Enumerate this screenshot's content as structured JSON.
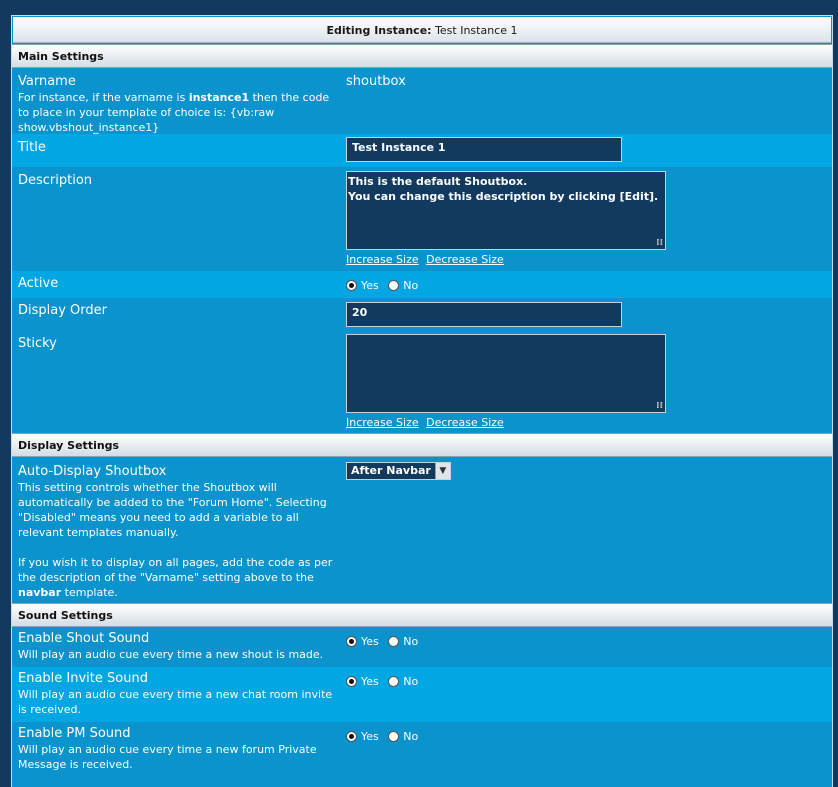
{
  "header": {
    "prefix": "Editing Instance:",
    "instance_name": "Test Instance 1"
  },
  "main_settings": {
    "section_title": "Main Settings",
    "varname": {
      "title": "Varname",
      "desc_pre": "For instance, if the varname is ",
      "desc_bold": "instance1",
      "desc_post": " then the code to place in your template of choice is: {vb:raw show.vbshout_instance1}",
      "value": "shoutbox"
    },
    "title": {
      "label": "Title",
      "value": "Test Instance 1"
    },
    "description": {
      "label": "Description",
      "line1": "This is the default Shoutbox.",
      "line2": "You can change this description by clicking [Edit].",
      "increase": "Increase Size",
      "decrease": "Decrease Size"
    },
    "active": {
      "label": "Active",
      "yes": "Yes",
      "no": "No",
      "selected": "Yes"
    },
    "display_order": {
      "label": "Display Order",
      "value": "20"
    },
    "sticky": {
      "label": "Sticky",
      "value": "",
      "increase": "Increase Size",
      "decrease": "Decrease Size"
    }
  },
  "display_settings": {
    "section_title": "Display Settings",
    "auto_display": {
      "label": "Auto-Display Shoutbox",
      "desc1": "This setting controls whether the Shoutbox will automatically be added to the \"Forum Home\". Selecting \"Disabled\" means you need to add a variable to all relevant templates manually.",
      "desc2_pre": "If you wish it to display on all pages, add the code as per the description of the \"Varname\" setting above to the ",
      "desc2_bold": "navbar",
      "desc2_post": " template.",
      "selected": "After Navbar"
    }
  },
  "sound_settings": {
    "section_title": "Sound Settings",
    "shout": {
      "label": "Enable Shout Sound",
      "desc": "Will play an audio cue every time a new shout is made.",
      "yes": "Yes",
      "no": "No",
      "selected": "Yes"
    },
    "invite": {
      "label": "Enable Invite Sound",
      "desc": "Will play an audio cue every time a new chat room invite is received.",
      "yes": "Yes",
      "no": "No",
      "selected": "Yes"
    },
    "pm": {
      "label": "Enable PM Sound",
      "desc": "Will play an audio cue every time a new forum Private Message is received.",
      "yes": "Yes",
      "no": "No",
      "selected": "Yes"
    }
  },
  "colors": {
    "page_bg": "#133a5e",
    "row_dark": "#0a93cc",
    "row_light": "#02a6e3",
    "input_bg": "#123a5e"
  }
}
